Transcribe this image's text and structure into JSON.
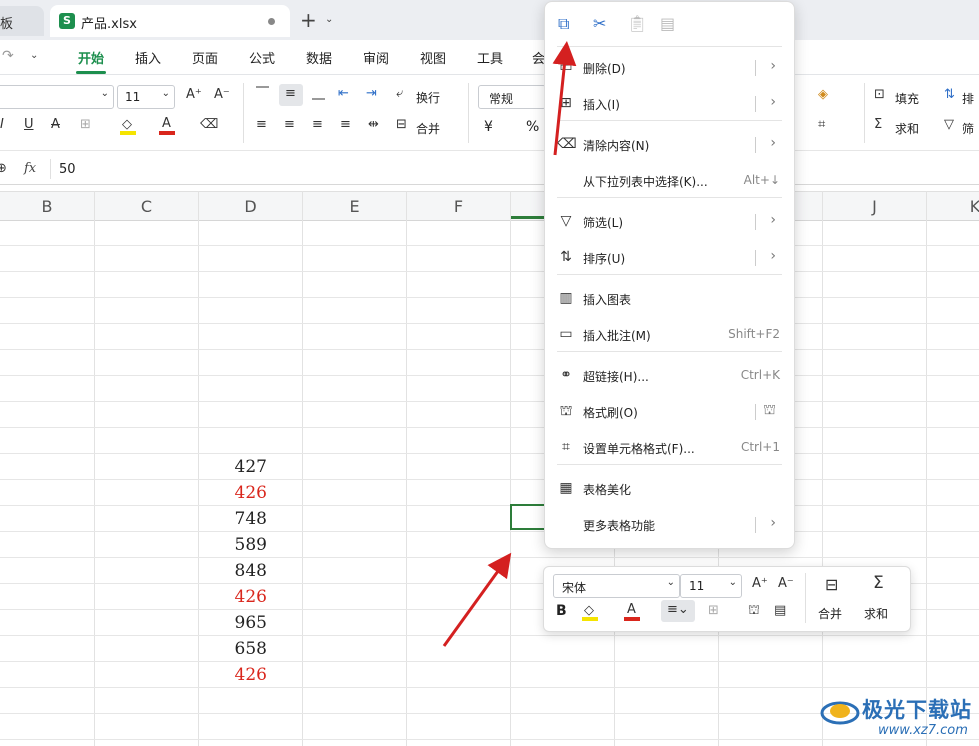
{
  "tabs": {
    "prev_partial": "板",
    "active": "产品.xlsx",
    "s_badge": "S"
  },
  "menu": [
    "开始",
    "插入",
    "页面",
    "公式",
    "数据",
    "审阅",
    "视图",
    "工具",
    "会"
  ],
  "ribbon": {
    "font_size": "11",
    "wrap": "换行",
    "merge": "合并",
    "number_format": "常规",
    "currency": "¥",
    "percent": "%",
    "fill": "填充",
    "sort_partial": "排",
    "sum": "求和",
    "filter_partial": "筛"
  },
  "formula_bar": {
    "fx": "fx",
    "value": "50"
  },
  "columns": [
    "B",
    "C",
    "D",
    "E",
    "F",
    "J",
    "K"
  ],
  "cells": [
    {
      "v": "427",
      "c": "#222"
    },
    {
      "v": "426",
      "c": "#d9261c"
    },
    {
      "v": "748",
      "c": "#222"
    },
    {
      "v": "589",
      "c": "#222"
    },
    {
      "v": "848",
      "c": "#222"
    },
    {
      "v": "426",
      "c": "#d9261c"
    },
    {
      "v": "965",
      "c": "#222"
    },
    {
      "v": "658",
      "c": "#222"
    },
    {
      "v": "426",
      "c": "#d9261c"
    }
  ],
  "context_menu": {
    "items": [
      {
        "label": "删除(D)",
        "shortcut": "",
        "icon": "delete-rows-icon"
      },
      {
        "label": "插入(I)",
        "shortcut": "",
        "icon": "insert-rows-icon"
      },
      {
        "label": "清除内容(N)",
        "shortcut": "",
        "icon": "eraser-icon"
      },
      {
        "label": "从下拉列表中选择(K)...",
        "shortcut": "Alt+↓",
        "icon": ""
      },
      {
        "label": "筛选(L)",
        "shortcut": "",
        "icon": "filter-icon"
      },
      {
        "label": "排序(U)",
        "shortcut": "",
        "icon": "sort-icon"
      },
      {
        "label": "插入图表",
        "shortcut": "",
        "icon": "chart-icon"
      },
      {
        "label": "插入批注(M)",
        "shortcut": "Shift+F2",
        "icon": "comment-icon"
      },
      {
        "label": "超链接(H)...",
        "shortcut": "Ctrl+K",
        "icon": "link-icon"
      },
      {
        "label": "格式刷(O)",
        "shortcut": "",
        "icon": "format-painter-icon"
      },
      {
        "label": "设置单元格格式(F)...",
        "shortcut": "Ctrl+1",
        "icon": "cell-format-icon"
      },
      {
        "label": "表格美化",
        "shortcut": "",
        "icon": "table-beautify-icon"
      },
      {
        "label": "更多表格功能",
        "shortcut": "",
        "icon": ""
      }
    ]
  },
  "mini_toolbar": {
    "font": "宋体",
    "size": "11",
    "bold": "B",
    "merge": "合并",
    "sum": "求和"
  },
  "watermark": {
    "name": "极光下载站",
    "url": "www.xz7.com"
  },
  "colors": {
    "accent": "#1d8f4e",
    "arrow": "#d42020",
    "selection": "#2d7d3a"
  }
}
